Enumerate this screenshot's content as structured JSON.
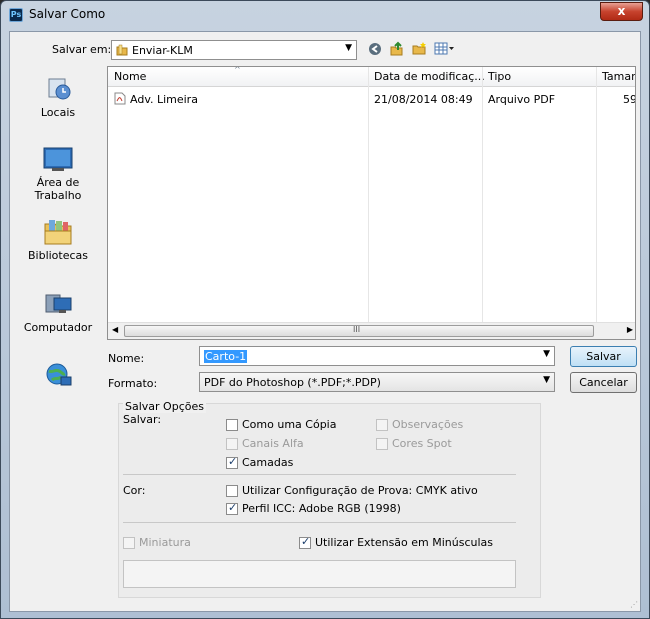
{
  "window": {
    "title": "Salvar Como",
    "app_badge": "Ps",
    "close_glyph": "x"
  },
  "location": {
    "label": "Salvar em:",
    "value": "Enviar-KLM"
  },
  "places": [
    {
      "label": "Locais"
    },
    {
      "label": "Área de\nTrabalho"
    },
    {
      "label": "Bibliotecas"
    },
    {
      "label": "Computador"
    },
    {
      "label": ""
    }
  ],
  "list": {
    "columns": [
      "Nome",
      "Data de modificaç...",
      "Tipo",
      "Tamanh"
    ],
    "rows": [
      {
        "name": "Adv. Limeira",
        "date": "21/08/2014 08:49",
        "type": "Arquivo PDF",
        "size": "59"
      }
    ],
    "scroll_glyph": "III"
  },
  "filename": {
    "label": "Nome:",
    "value": "Carto-1"
  },
  "format": {
    "label": "Formato:",
    "value": "PDF do Photoshop (*.PDF;*.PDP)"
  },
  "buttons": {
    "save": "Salvar",
    "cancel": "Cancelar"
  },
  "options": {
    "title": "Salvar Opções",
    "save_label": "Salvar:",
    "color_label": "Cor:",
    "as_copy": {
      "label": "Como uma Cópia",
      "checked": false,
      "enabled": true
    },
    "notes": {
      "label": "Observações",
      "checked": false,
      "enabled": false
    },
    "alpha": {
      "label": "Canais Alfa",
      "checked": false,
      "enabled": false
    },
    "spot": {
      "label": "Cores Spot",
      "checked": false,
      "enabled": false
    },
    "layers": {
      "label": "Camadas",
      "checked": true,
      "enabled": true
    },
    "proof": {
      "label": "Utilizar Configuração de Prova: CMYK ativo",
      "checked": false,
      "enabled": true
    },
    "icc": {
      "label": "Perfil ICC: Adobe RGB (1998)",
      "checked": true,
      "enabled": true
    },
    "thumbnail": {
      "label": "Miniatura",
      "checked": false,
      "enabled": false
    },
    "lowercase": {
      "label": "Utilizar Extensão em Minúsculas",
      "checked": true,
      "enabled": true
    }
  }
}
